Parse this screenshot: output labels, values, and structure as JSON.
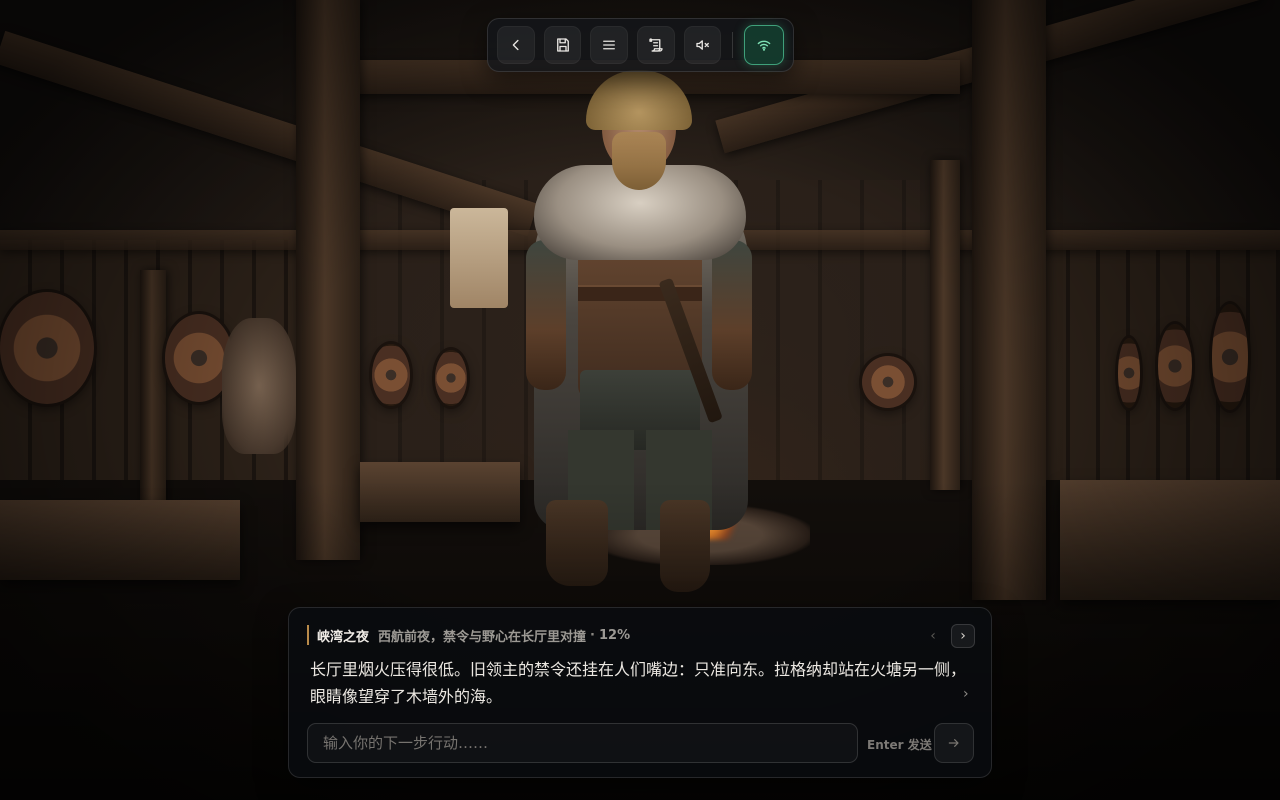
{
  "toolbar": {
    "buttons": [
      {
        "icon": "back-icon",
        "label": "back"
      },
      {
        "icon": "save-icon",
        "label": "save"
      },
      {
        "icon": "menu-icon",
        "label": "menu"
      },
      {
        "icon": "scroll-icon",
        "label": "log"
      },
      {
        "icon": "mute-icon",
        "label": "mute"
      },
      {
        "icon": "wifi-icon",
        "label": "connection",
        "active": true
      }
    ],
    "active_color": "#3fa07a"
  },
  "dialog": {
    "chapter": "峡湾之夜",
    "subtitle": "西航前夜，禁令与野心在长厅里对撞",
    "separator": "·",
    "progress": "12%",
    "progress_value": 0.12,
    "text": "长厅里烟火压得很低。旧领主的禁令还挂在人们嘴边：只准向东。拉格纳却站在火塘另一侧，眼睛像望穿了木墙外的海。",
    "prev_glyph": "‹",
    "next_glyph": "›",
    "more_glyph": "›",
    "accent_color": "#b88a4a"
  },
  "input": {
    "placeholder": "输入你的下一步行动……",
    "value": "",
    "send_hint": "Enter 发送"
  }
}
